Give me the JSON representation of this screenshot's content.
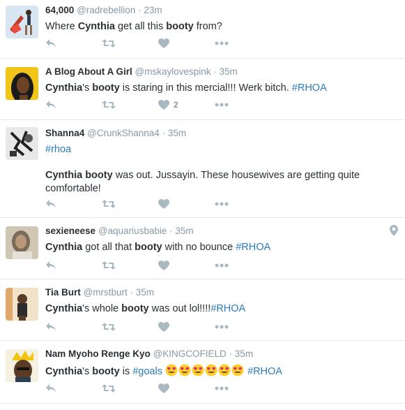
{
  "tweets": [
    {
      "name": "64,000",
      "handle": "@radrebellion",
      "time": "23m",
      "segments": [
        {
          "t": "Where "
        },
        {
          "t": "Cynthia",
          "b": true
        },
        {
          "t": " get all this "
        },
        {
          "t": "booty",
          "b": true
        },
        {
          "t": " from?"
        }
      ],
      "likes": ""
    },
    {
      "name": "A Blog About A Girl",
      "handle": "@mskaylovespink",
      "time": "35m",
      "segments": [
        {
          "t": "Cynthia",
          "b": true
        },
        {
          "t": "'s "
        },
        {
          "t": "booty",
          "b": true
        },
        {
          "t": " is staring in this mercial!!! Werk bitch. "
        },
        {
          "t": "#RHOA",
          "h": true
        }
      ],
      "likes": "2"
    },
    {
      "name": "Shanna4",
      "handle": "@CrunkShanna4",
      "time": "35m",
      "segments": [
        {
          "t": "#rhoa",
          "h": true
        }
      ],
      "segments2": [
        {
          "t": "Cynthia",
          "b": true
        },
        {
          "t": " "
        },
        {
          "t": "booty",
          "b": true
        },
        {
          "t": " was out. Jussayin. These housewives are getting quite comfortable!"
        }
      ],
      "likes": ""
    },
    {
      "name": "sexieneese",
      "handle": "@aquariusbabie",
      "time": "35m",
      "segments": [
        {
          "t": "Cynthia",
          "b": true
        },
        {
          "t": " got all that "
        },
        {
          "t": "booty",
          "b": true
        },
        {
          "t": " with no bounce  "
        },
        {
          "t": "#RHOA",
          "h": true
        }
      ],
      "likes": ""
    },
    {
      "name": "Tia Burt",
      "handle": "@mrstburt",
      "time": "35m",
      "segments": [
        {
          "t": "Cynthia",
          "b": true
        },
        {
          "t": "'s whole "
        },
        {
          "t": "booty",
          "b": true
        },
        {
          "t": " was out lol!!!!"
        },
        {
          "t": "#RHOA",
          "h": true
        }
      ],
      "likes": ""
    },
    {
      "name": "Nam Myoho Renge Kyo",
      "handle": "@KINGCOFIELD",
      "time": "35m",
      "segments": [
        {
          "t": "Cynthia",
          "b": true
        },
        {
          "t": "'s "
        },
        {
          "t": "booty",
          "b": true
        },
        {
          "t": " is "
        },
        {
          "t": "#goals",
          "h": true
        },
        {
          "t": " "
        }
      ],
      "emoji": [
        "heart-eyes-emoji",
        "heart-eyes-emoji",
        "heart-eyes-emoji",
        "heart-eyes-emoji",
        "heart-eyes-emoji",
        "heart-eyes-emoji"
      ],
      "segments_after": [
        {
          "t": " "
        },
        {
          "t": "#RHOA",
          "h": true
        }
      ],
      "likes": ""
    }
  ],
  "separator": "·",
  "colors": {
    "hashtag": "#2b7bb9",
    "muted": "#8899a6",
    "icon": "#aab8c2"
  }
}
